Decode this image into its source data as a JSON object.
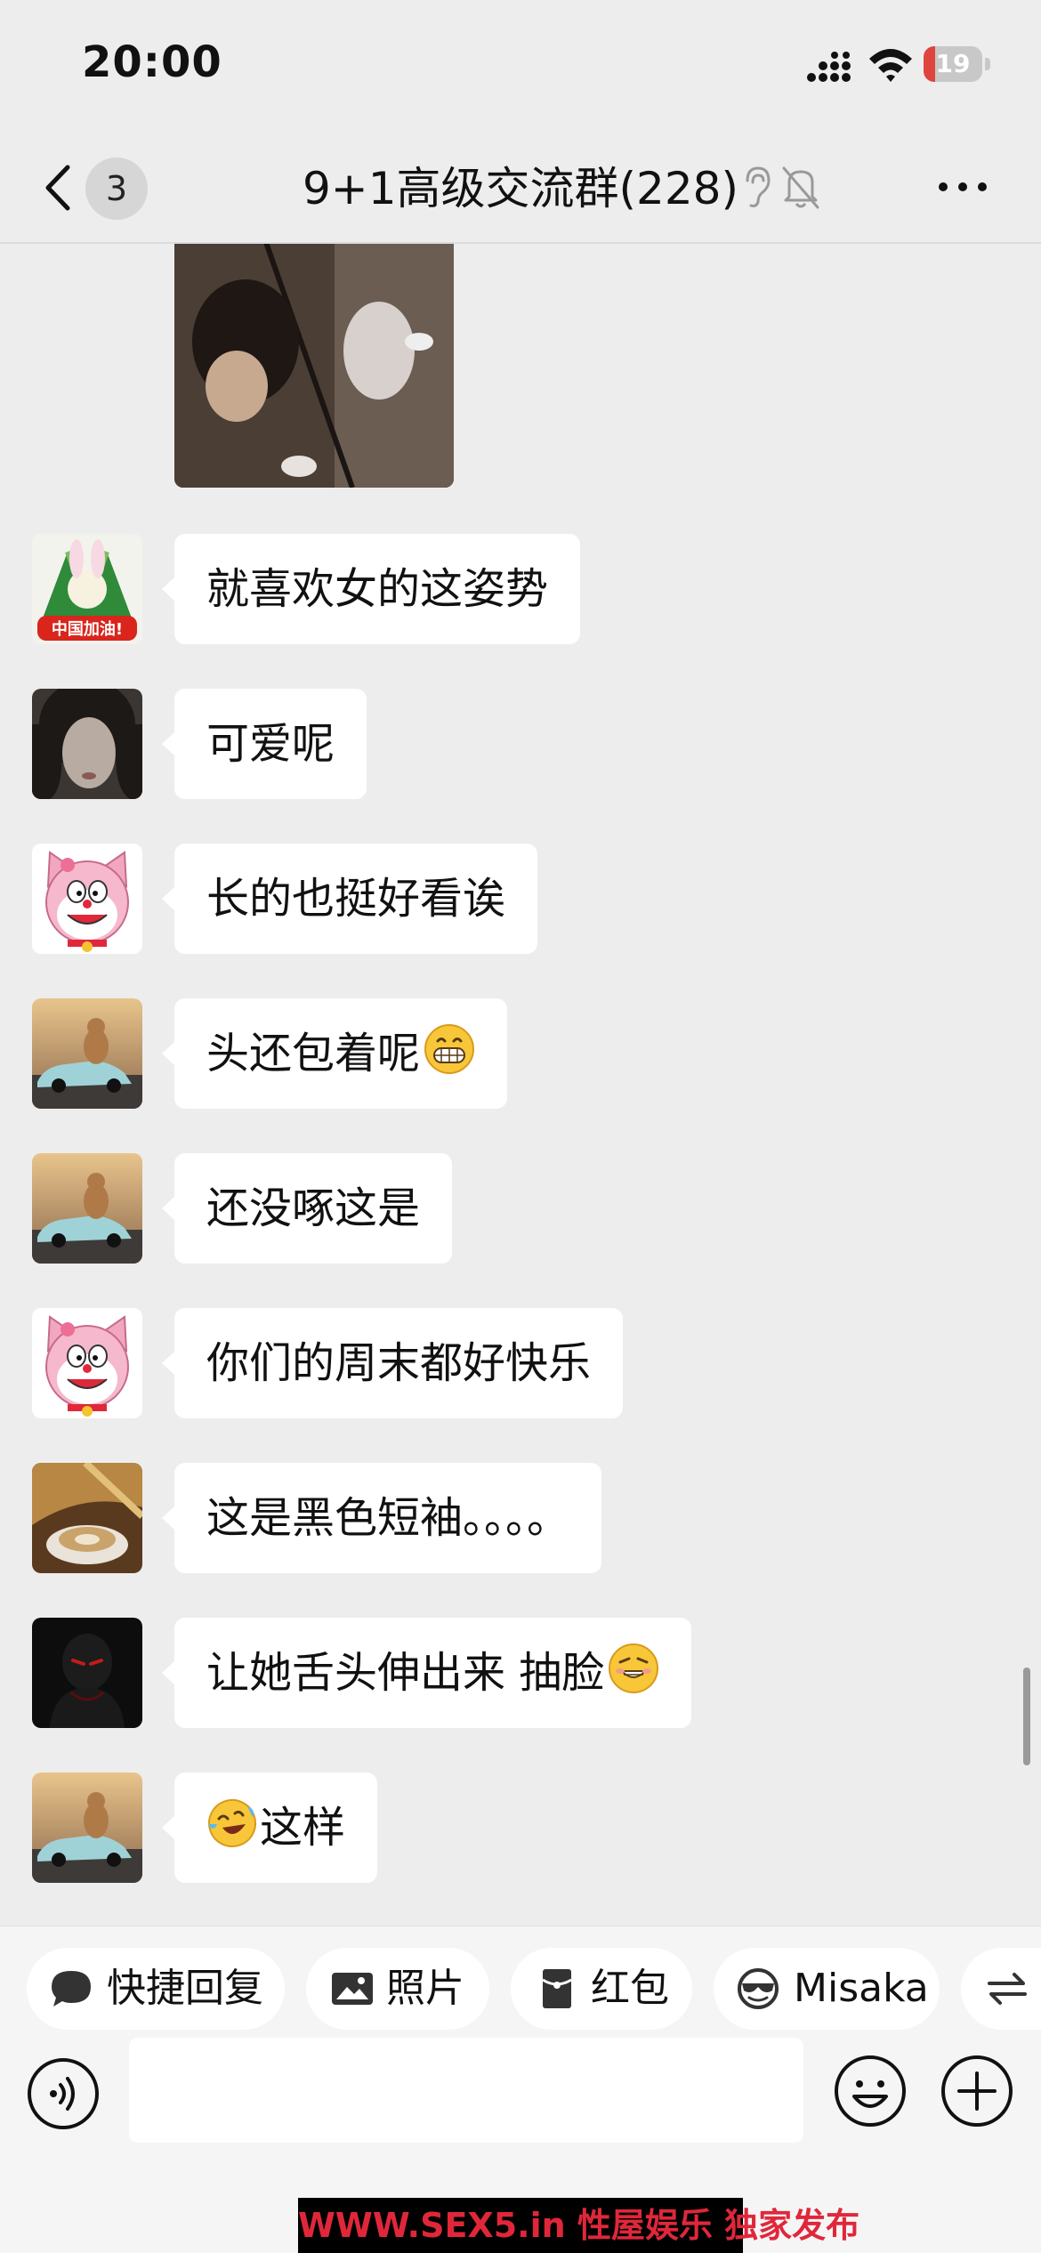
{
  "status_bar": {
    "time": "20:00",
    "battery": "19",
    "battery_level": 0.19
  },
  "nav": {
    "unread_count": "3",
    "title": "9+1高级交流群(228)"
  },
  "messages": [
    {
      "avatar": "china-cheer-avatar",
      "text": "就喜欢女的这姿势"
    },
    {
      "avatar": "woman-portrait-avatar",
      "text": "可爱呢"
    },
    {
      "avatar": "pink-cat-avatar",
      "text": "长的也挺好看诶"
    },
    {
      "avatar": "sports-car-avatar",
      "text": "头还包着呢",
      "emoji_after": "grinning-face-emoji"
    },
    {
      "avatar": "sports-car-avatar",
      "text": "还没啄这是"
    },
    {
      "avatar": "pink-cat-avatar",
      "text": "你们的周末都好快乐"
    },
    {
      "avatar": "coffee-avatar",
      "text": "这是黑色短袖。。。。"
    },
    {
      "avatar": "dark-figure-avatar",
      "text": "让她舌头伸出来 抽脸",
      "emoji_after": "smirk-face-emoji"
    },
    {
      "avatar": "sports-car-avatar",
      "text": "这样",
      "emoji_before": "crying-laughing-emoji"
    }
  ],
  "quick_actions": [
    {
      "label": "快捷回复",
      "icon": "speech-bubble-icon"
    },
    {
      "label": "照片",
      "icon": "image-icon"
    },
    {
      "label": "红包",
      "icon": "red-packet-icon"
    },
    {
      "label": "Misaka",
      "icon": "sunglasses-emoji-icon"
    },
    {
      "label": "",
      "icon": "switch-arrows-icon"
    }
  ],
  "input": {
    "value": "",
    "placeholder": ""
  },
  "watermark": "WWW.SEX5.in 性屋娱乐 独家发布",
  "colors": {
    "background": "#ededed",
    "bubble": "#ffffff",
    "battery_low": "#e0443e",
    "watermark_text": "#e0273a"
  }
}
